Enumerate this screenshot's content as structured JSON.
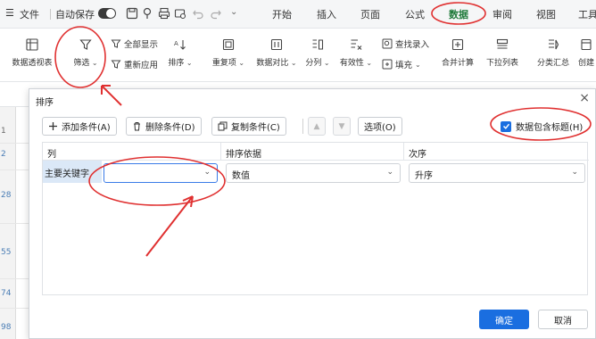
{
  "menubar": {
    "file": "文件",
    "autosave": "自动保存",
    "tabs": [
      "开始",
      "插入",
      "页面",
      "公式",
      "数据",
      "审阅",
      "视图",
      "工具"
    ]
  },
  "ribbon": {
    "pivot": "数据透视表",
    "filter": "筛选",
    "show_all": "全部显示",
    "reapply": "重新应用",
    "sort": "排序",
    "duplicates": "重复项",
    "compare": "数据对比",
    "split": "分列",
    "validity": "有效性",
    "find_entry": "查找录入",
    "fill": "填充",
    "consolidate": "合并计算",
    "dropdown": "下拉列表",
    "subtotal": "分类汇总",
    "create": "创建"
  },
  "sheet": {
    "rows": [
      "1",
      "2",
      "28",
      "55",
      "74",
      "98"
    ]
  },
  "dialog": {
    "title": "排序",
    "add_condition": "添加条件(A)",
    "delete_condition": "删除条件(D)",
    "copy_condition": "复制条件(C)",
    "options": "选项(O)",
    "has_header": "数据包含标题(H)",
    "col_header": "列",
    "basis_header": "排序依据",
    "order_header": "次序",
    "primary_key": "主要关键字",
    "key_value": "",
    "basis_value": "数值",
    "order_value": "升序",
    "ok": "确定",
    "cancel": "取消"
  },
  "colors": {
    "accent": "#1a6ee0",
    "data_tab": "#1f7a3a",
    "annotation": "#e03030"
  }
}
